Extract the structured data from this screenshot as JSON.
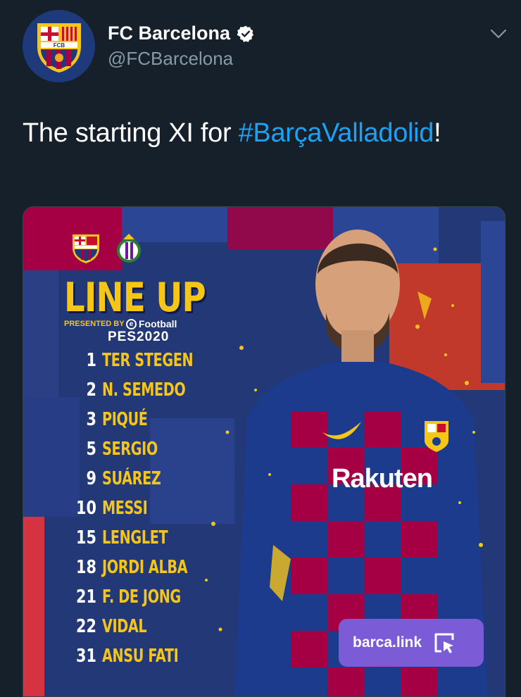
{
  "account": {
    "display_name": "FC Barcelona",
    "handle": "@FCBarcelona",
    "verified_icon": "verified-badge-icon",
    "avatar_icon": "fc-barcelona-crest-icon",
    "avatar_crest_text": "FCB"
  },
  "tweet": {
    "text_prefix": "The starting XI for ",
    "hashtag": "#BarçaValladolid",
    "text_suffix": "!"
  },
  "media": {
    "title": "LINE UP",
    "presented_by": "PRESENTED BY",
    "sponsor": "Football",
    "sponsor_icon": "efootball-e-icon",
    "game": "PES2020",
    "shirt_sponsor": "Rakuten",
    "players": [
      {
        "number": "1",
        "name": "TER STEGEN"
      },
      {
        "number": "2",
        "name": "N. SEMEDO"
      },
      {
        "number": "3",
        "name": "PIQUÉ"
      },
      {
        "number": "5",
        "name": "SERGIO"
      },
      {
        "number": "9",
        "name": "SUÁREZ"
      },
      {
        "number": "10",
        "name": "MESSI"
      },
      {
        "number": "15",
        "name": "LENGLET"
      },
      {
        "number": "18",
        "name": "JORDI ALBA"
      },
      {
        "number": "21",
        "name": "F. DE JONG"
      },
      {
        "number": "22",
        "name": "VIDAL"
      },
      {
        "number": "31",
        "name": "ANSU FATI"
      }
    ],
    "link_label": "barca.link",
    "link_icon": "external-link-cursor-icon"
  },
  "colors": {
    "background": "#15202b",
    "hashtag": "#1da1f2",
    "handle": "#8899a6",
    "lineup_yellow": "#f5c518",
    "blaugrana_blue": "#233876",
    "blaugrana_red": "#a50044",
    "link_purple": "#7b5cd6"
  }
}
